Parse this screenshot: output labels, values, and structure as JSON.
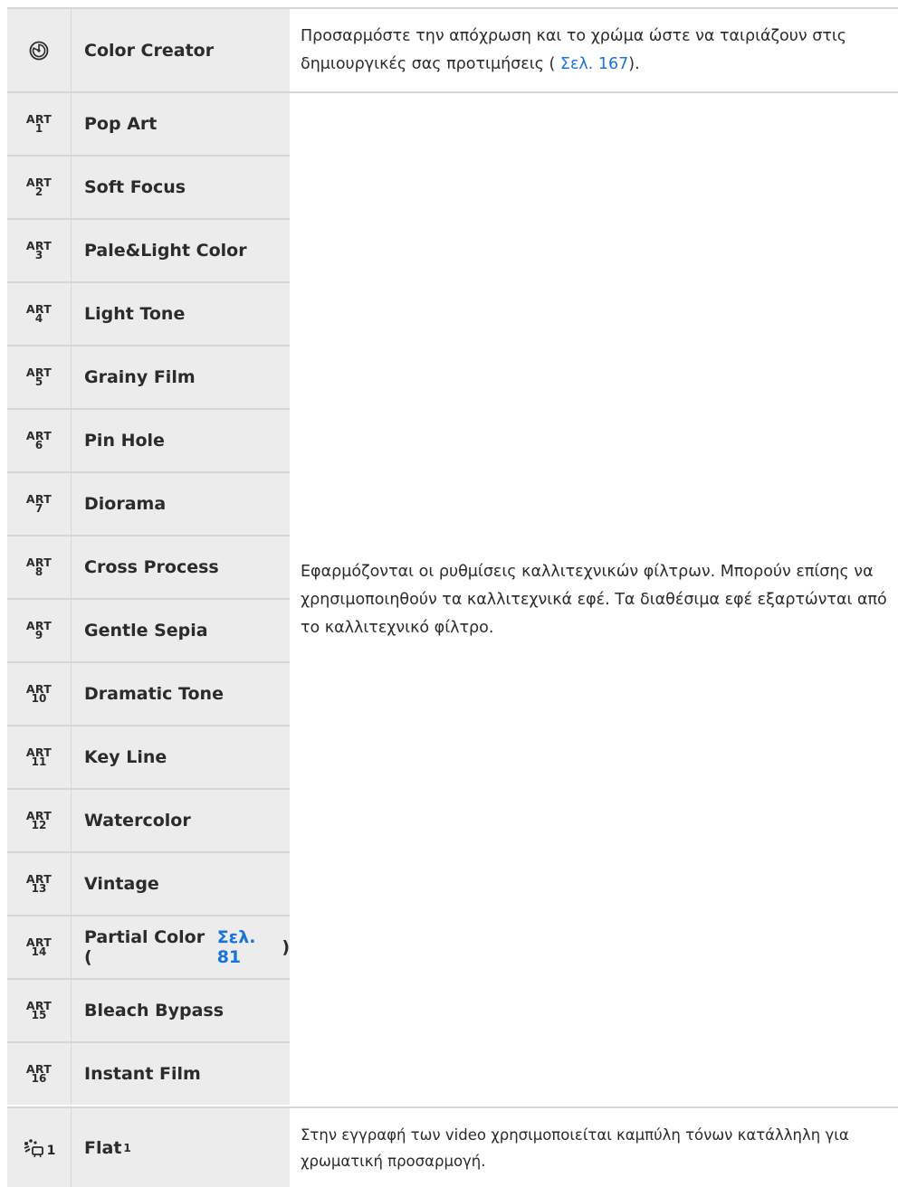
{
  "rows": {
    "color_creator": {
      "icon": "color-creator-icon",
      "name": "Color Creator",
      "desc_text": "Προσαρμόστε την απόχρωση και το χρώμα ώστε να ταιριάζουν στις δημιουργικές σας προτιμήσεις (",
      "desc_link": "Σελ. 167",
      "desc_end": ")."
    },
    "art_label": "ART",
    "art_filters": [
      {
        "num": "1",
        "name": "Pop Art"
      },
      {
        "num": "2",
        "name": "Soft Focus"
      },
      {
        "num": "3",
        "name": "Pale&Light Color"
      },
      {
        "num": "4",
        "name": "Light Tone"
      },
      {
        "num": "5",
        "name": "Grainy Film"
      },
      {
        "num": "6",
        "name": "Pin Hole"
      },
      {
        "num": "7",
        "name": "Diorama"
      },
      {
        "num": "8",
        "name": "Cross Process"
      },
      {
        "num": "9",
        "name": "Gentle Sepia"
      },
      {
        "num": "10",
        "name": "Dramatic Tone"
      },
      {
        "num": "11",
        "name": "Key Line"
      },
      {
        "num": "12",
        "name": "Watercolor"
      },
      {
        "num": "13",
        "name": "Vintage"
      },
      {
        "num": "14",
        "name": "Partial Color (",
        "link": "Σελ. 81",
        "end": ")"
      },
      {
        "num": "15",
        "name": "Bleach Bypass"
      },
      {
        "num": "16",
        "name": "Instant Film"
      }
    ],
    "art_desc": "Εφαρμόζονται οι ρυθμίσεις καλλιτεχνικών φίλτρων. Μπορούν επίσης να χρησιμοποιηθούν τα καλλιτεχνικά εφέ. Τα διαθέσιμα εφέ εξαρτώνται από το καλλιτεχνικό φίλτρο.",
    "flat": {
      "icon": "flat-video-icon",
      "icon_sub": "1",
      "name": "Flat",
      "sup": "1",
      "desc": "Στην εγγραφή των video χρησιμοποιείται καμπύλη τόνων κατάλληλη για χρωματική προσαρμογή."
    }
  },
  "colors": {
    "cell_bg": "#ececec",
    "divider": "#d6d6d6",
    "link": "#1a73d9"
  }
}
